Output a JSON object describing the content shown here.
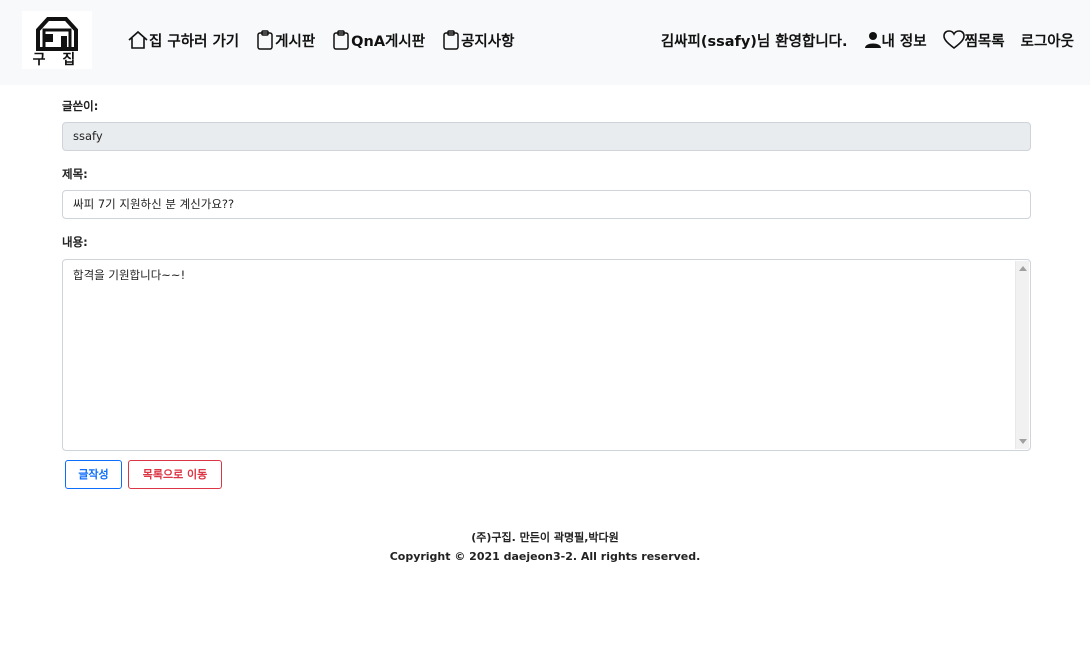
{
  "header": {
    "logo_text": "구 집",
    "nav_left": [
      {
        "label": "집 구하러 가기",
        "icon": "house-icon"
      },
      {
        "label": "게시판",
        "icon": "clipboard-icon"
      },
      {
        "label": "QnA게시판",
        "icon": "clipboard-icon"
      },
      {
        "label": "공지사항",
        "icon": "clipboard-icon"
      }
    ],
    "welcome": "김싸피(ssafy)님 환영합니다.",
    "my_info": "내 정보",
    "wishlist": "찜목록",
    "logout": "로그아웃"
  },
  "form": {
    "author_label": "글쓴이:",
    "author_value": "ssafy",
    "title_label": "제목:",
    "title_value": "싸피 7기 지원하신 분 계신가요??",
    "content_label": "내용:",
    "content_value": "합격을 기원합니다~~!"
  },
  "buttons": {
    "write": "글작성",
    "to_list": "목록으로 이동"
  },
  "footer": {
    "line1": "(주)구집. 만든이 곽명필,박다원",
    "line2": "Copyright © 2021 daejeon3-2. All rights reserved."
  },
  "colors": {
    "navbar_bg": "#f8f9fa",
    "primary": "#0d6efd",
    "danger": "#dc3545",
    "readonly_bg": "#e9ecef"
  }
}
